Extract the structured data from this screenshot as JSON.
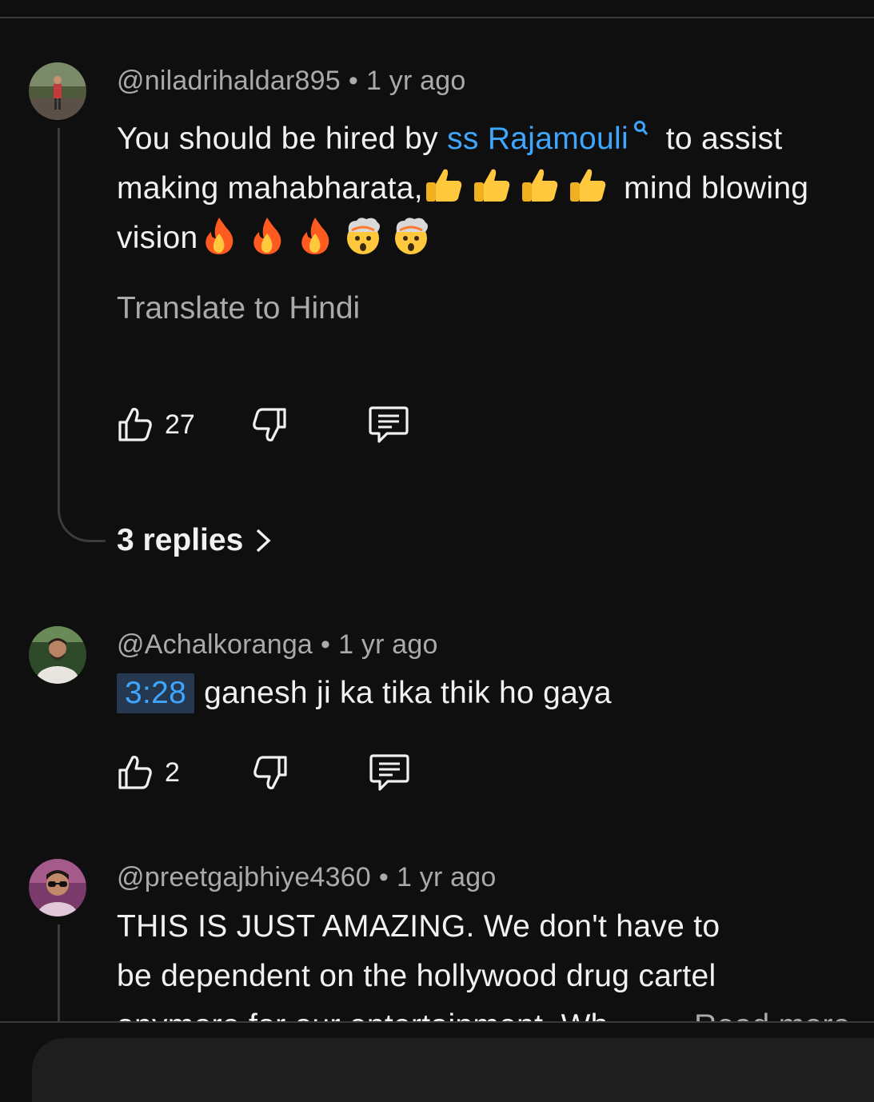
{
  "comments": [
    {
      "author": "@niladrihaldar895",
      "time": "1 yr ago",
      "text_part1": "You should be hired by ",
      "link_text": "ss Rajamouli",
      "text_part2": "to assist making mahabharata,",
      "text_part3": " mind blowing vision",
      "translate_label": "Translate to Hindi",
      "likes": "27",
      "replies_label": "3 replies"
    },
    {
      "author": "@Achalkoranga",
      "time": "1 yr ago",
      "timestamp": "3:28",
      "text": "ganesh ji ka tika thik ho gaya",
      "likes": "2"
    },
    {
      "author": "@preetgajbhiye4360",
      "time": "1 yr ago",
      "text": "THIS IS JUST AMAZING. We don't have to be dependent on the hollywood drug cartel anymore for our entertainment. Wh...",
      "read_more": "Read more"
    }
  ],
  "separator": "•",
  "colors": {
    "background": "#0f0f0f",
    "link": "#3ea6ff",
    "secondary_text": "#aaaaaa"
  }
}
